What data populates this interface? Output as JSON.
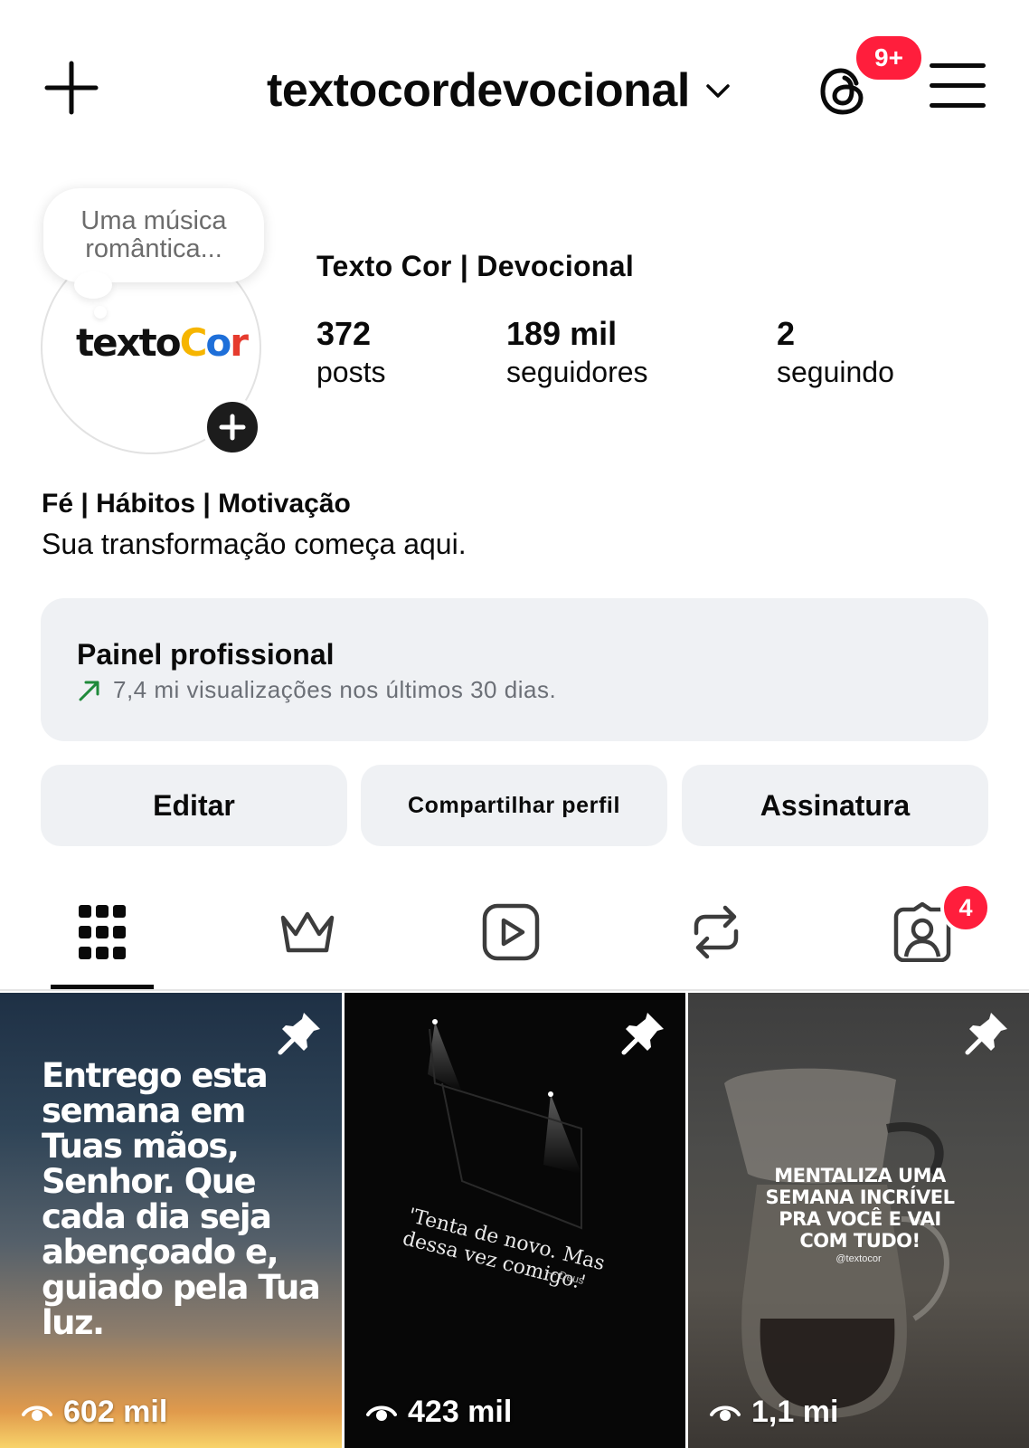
{
  "header": {
    "username": "textocordevocional",
    "threads_badge": "9+"
  },
  "profile": {
    "note": "Uma música romântica...",
    "logo_text": {
      "part1": "texto",
      "c": "C",
      "o": "o",
      "r": "r"
    },
    "display_name": "Texto Cor | Devocional",
    "stats": [
      {
        "value": "372",
        "label": "posts"
      },
      {
        "value": "189 mil",
        "label": "seguidores"
      },
      {
        "value": "2",
        "label": "seguindo"
      }
    ],
    "bio_category": "Fé | Hábitos | Motivação",
    "bio_text": "Sua transformação começa aqui."
  },
  "panel": {
    "title": "Painel profissional",
    "subtitle": "7,4 mi visualizações nos últimos 30 dias."
  },
  "actions": {
    "edit": "Editar",
    "share": "Compartilhar perfil",
    "subscription": "Assinatura"
  },
  "tabs": {
    "tagged_badge": "4",
    "active": "grid"
  },
  "posts": [
    {
      "text": "Entrego esta semana em Tuas mãos, Senhor. Que cada dia seja abençoado e, guiado pela Tua luz.",
      "views": "602 mil",
      "pinned": true
    },
    {
      "text": "'Tenta de novo. Mas dessa vez comigo.'",
      "signature": "— Deus",
      "views": "423 mil",
      "pinned": true
    },
    {
      "text": "MENTALIZA UMA SEMANA INCRÍVEL PRA VOCÊ E VAI COM TUDO!",
      "tag": "@textocor",
      "views": "1,1 mi",
      "pinned": true
    }
  ],
  "colors": {
    "badge_red": "#ff1e3c",
    "panel_bg": "#eff1f4",
    "trend_green": "#1f8a3a"
  }
}
